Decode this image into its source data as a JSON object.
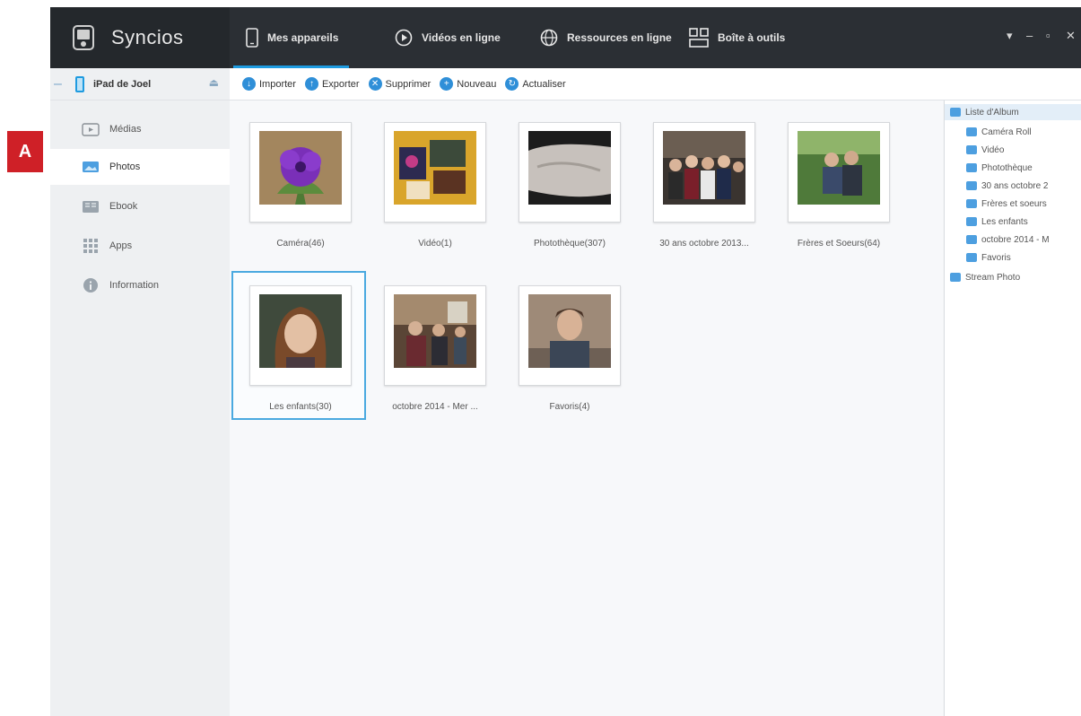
{
  "annotation": {
    "label": "A",
    "color": "#cf2027"
  },
  "app": {
    "name": "Syncios"
  },
  "nav": {
    "tabs": [
      {
        "label": "Mes appareils",
        "icon": "phone-icon",
        "active": true
      },
      {
        "label": "Vidéos en ligne",
        "icon": "play-icon"
      },
      {
        "label": "Ressources en ligne",
        "icon": "globe-icon"
      },
      {
        "label": "Boîte à outils",
        "icon": "toolbox-icon"
      }
    ],
    "window_controls": [
      "▾",
      "–",
      "▫",
      "✕"
    ]
  },
  "device": {
    "name": "iPad de Joel"
  },
  "toolbar": {
    "buttons": [
      {
        "label": "Importer",
        "icon": "import-icon"
      },
      {
        "label": "Exporter",
        "icon": "export-icon"
      },
      {
        "label": "Supprimer",
        "icon": "delete-icon"
      },
      {
        "label": "Nouveau",
        "icon": "new-icon"
      },
      {
        "label": "Actualiser",
        "icon": "refresh-icon"
      }
    ]
  },
  "sidebar": {
    "items": [
      {
        "label": "Médias",
        "icon": "media-icon"
      },
      {
        "label": "Photos",
        "icon": "photos-icon",
        "active": true
      },
      {
        "label": "Ebook",
        "icon": "ebook-icon"
      },
      {
        "label": "Apps",
        "icon": "apps-icon"
      },
      {
        "label": "Information",
        "icon": "info-icon"
      }
    ]
  },
  "albums": [
    {
      "label": "Caméra(46)"
    },
    {
      "label": "Vidéo(1)"
    },
    {
      "label": "Photothèque(307)"
    },
    {
      "label": "30 ans octobre 2013..."
    },
    {
      "label": "Frères et Soeurs(64)"
    },
    {
      "label": "Les enfants(30)",
      "selected": true
    },
    {
      "label": "octobre 2014 - Mer ..."
    },
    {
      "label": "Favoris(4)"
    }
  ],
  "album_list": {
    "header": "Liste d'Album",
    "items": [
      "Caméra Roll",
      "Vidéo",
      "Photothèque",
      "30 ans octobre 2",
      "Frères et soeurs",
      "Les enfants",
      "octobre 2014 - M",
      "Favoris"
    ],
    "footer": "Stream Photo"
  }
}
